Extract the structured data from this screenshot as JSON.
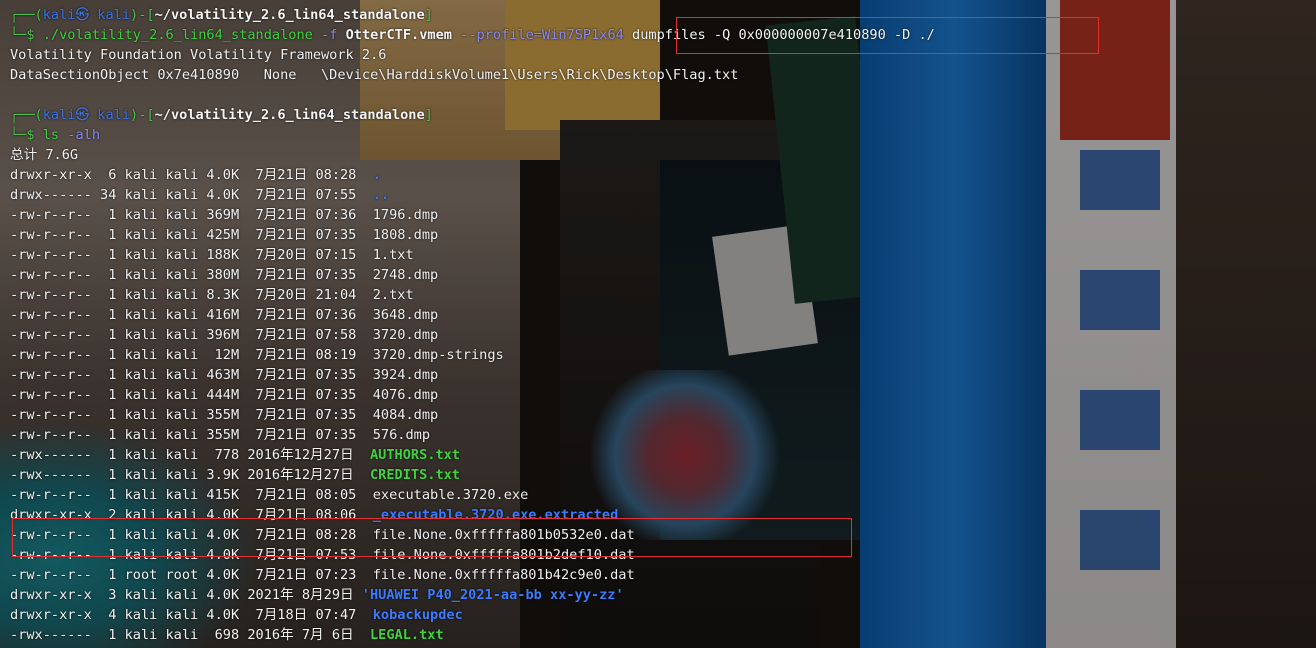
{
  "prompt1": {
    "bracket_start": "┌──(",
    "user": "kali㉿ kali",
    "bracket_mid": ")-[",
    "path": "~/volatility_2.6_lin64_standalone",
    "bracket_end": "]",
    "arrow": "└─$ ",
    "cmd": "./volatility_2.6_lin64_standalone",
    "args1": " -f ",
    "file": "OtterCTF.vmem",
    "args2": " --profile=Win7SP1x64 ",
    "args3": "dumpfiles -Q 0x000000007e410890 -D ./"
  },
  "output1": [
    "Volatility Foundation Volatility Framework 2.6",
    "DataSectionObject 0x7e410890   None   \\Device\\HarddiskVolume1\\Users\\Rick\\Desktop\\Flag.txt"
  ],
  "prompt2": {
    "bracket_start": "┌──(",
    "user": "kali㉿ kali",
    "bracket_mid": ")-[",
    "path": "~/volatility_2.6_lin64_standalone",
    "bracket_end": "]",
    "arrow": "└─$ ",
    "cmd": "ls",
    "args": " -alh"
  },
  "total": "总计 7.6G",
  "listing": [
    {
      "meta": "drwxr-xr-x  6 kali kali 4.0K  7月21日 08:28  ",
      "name": ".",
      "kind": "dir"
    },
    {
      "meta": "drwx------ 34 kali kali 4.0K  7月21日 07:55  ",
      "name": "..",
      "kind": "dir"
    },
    {
      "meta": "-rw-r--r--  1 kali kali 369M  7月21日 07:36  ",
      "name": "1796.dmp",
      "kind": "file"
    },
    {
      "meta": "-rw-r--r--  1 kali kali 425M  7月21日 07:35  ",
      "name": "1808.dmp",
      "kind": "file"
    },
    {
      "meta": "-rw-r--r--  1 kali kali 188K  7月20日 07:15  ",
      "name": "1.txt",
      "kind": "file"
    },
    {
      "meta": "-rw-r--r--  1 kali kali 380M  7月21日 07:35  ",
      "name": "2748.dmp",
      "kind": "file"
    },
    {
      "meta": "-rw-r--r--  1 kali kali 8.3K  7月20日 21:04  ",
      "name": "2.txt",
      "kind": "file"
    },
    {
      "meta": "-rw-r--r--  1 kali kali 416M  7月21日 07:36  ",
      "name": "3648.dmp",
      "kind": "file"
    },
    {
      "meta": "-rw-r--r--  1 kali kali 396M  7月21日 07:58  ",
      "name": "3720.dmp",
      "kind": "file"
    },
    {
      "meta": "-rw-r--r--  1 kali kali  12M  7月21日 08:19  ",
      "name": "3720.dmp-strings",
      "kind": "file"
    },
    {
      "meta": "-rw-r--r--  1 kali kali 463M  7月21日 07:35  ",
      "name": "3924.dmp",
      "kind": "file"
    },
    {
      "meta": "-rw-r--r--  1 kali kali 444M  7月21日 07:35  ",
      "name": "4076.dmp",
      "kind": "file"
    },
    {
      "meta": "-rw-r--r--  1 kali kali 355M  7月21日 07:35  ",
      "name": "4084.dmp",
      "kind": "file"
    },
    {
      "meta": "-rw-r--r--  1 kali kali 355M  7月21日 07:35  ",
      "name": "576.dmp",
      "kind": "file"
    },
    {
      "meta": "-rwx------  1 kali kali  778 2016年12月27日  ",
      "name": "AUTHORS.txt",
      "kind": "exe"
    },
    {
      "meta": "-rwx------  1 kali kali 3.9K 2016年12月27日  ",
      "name": "CREDITS.txt",
      "kind": "exe"
    },
    {
      "meta": "-rw-r--r--  1 kali kali 415K  7月21日 08:05  ",
      "name": "executable.3720.exe",
      "kind": "file"
    },
    {
      "meta": "drwxr-xr-x  2 kali kali 4.0K  7月21日 08:06  ",
      "name": "_executable.3720.exe.extracted",
      "kind": "dir"
    },
    {
      "meta": "-rw-r--r--  1 kali kali 4.0K  7月21日 08:28  ",
      "name": "file.None.0xfffffa801b0532e0.dat",
      "kind": "file"
    },
    {
      "meta": "-rw-r--r--  1 kali kali 4.0K  7月21日 07:53  ",
      "name": "file.None.0xfffffa801b2def10.dat",
      "kind": "file"
    },
    {
      "meta": "-rw-r--r--  1 root root 4.0K  7月21日 07:23  ",
      "name": "file.None.0xfffffa801b42c9e0.dat",
      "kind": "file"
    },
    {
      "meta": "drwxr-xr-x  3 kali kali 4.0K 2021年 8月29日 ",
      "name": "'HUAWEI P40_2021-aa-bb xx-yy-zz'",
      "kind": "dir"
    },
    {
      "meta": "drwxr-xr-x  4 kali kali 4.0K  7月18日 07:47  ",
      "name": "kobackupdec",
      "kind": "dir"
    },
    {
      "meta": "-rwx------  1 kali kali  698 2016年 7月 6日  ",
      "name": "LEGAL.txt",
      "kind": "exe"
    }
  ]
}
